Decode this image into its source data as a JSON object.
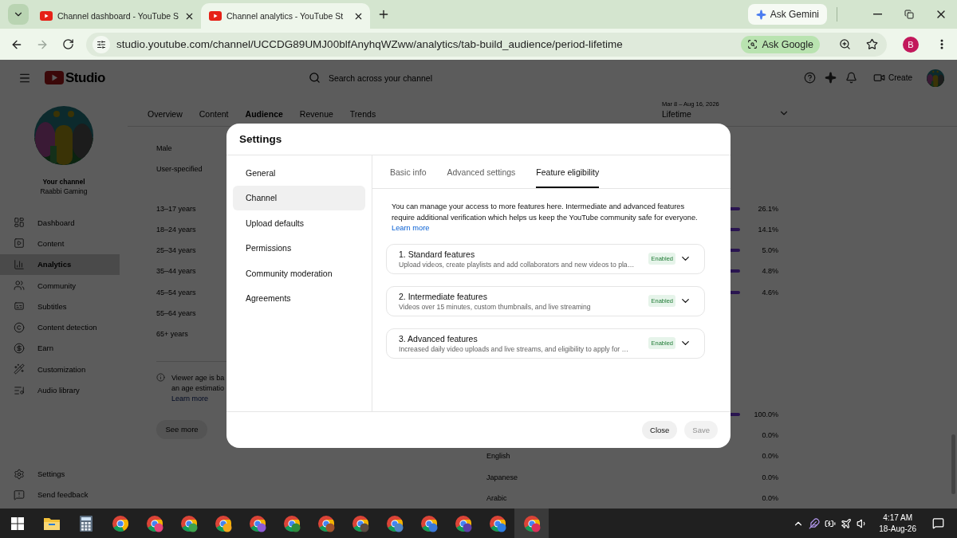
{
  "browser": {
    "tabs": [
      {
        "title": "Channel dashboard - YouTube S",
        "selected": false
      },
      {
        "title": "Channel analytics - YouTube St",
        "selected": true
      }
    ],
    "gemini_button": "Ask Gemini",
    "url": "studio.youtube.com/channel/UCCDG89UMJ00blfAnyhqWZww/analytics/tab-build_audience/period-lifetime",
    "ask_google": "Ask Google",
    "profile_initial": "B"
  },
  "studio": {
    "logo": "Studio",
    "search_placeholder": "Search across your channel",
    "create_button": "Create",
    "channel": {
      "label": "Your channel",
      "name": "Raabbi Gaming"
    },
    "nav": [
      {
        "label": "Dashboard",
        "kind": "dashboard",
        "selected": false
      },
      {
        "label": "Content",
        "kind": "content",
        "selected": false
      },
      {
        "label": "Analytics",
        "kind": "analytics",
        "selected": true
      },
      {
        "label": "Community",
        "kind": "community",
        "selected": false
      },
      {
        "label": "Subtitles",
        "kind": "subtitles",
        "selected": false
      },
      {
        "label": "Content detection",
        "kind": "detection",
        "selected": false
      },
      {
        "label": "Earn",
        "kind": "earn",
        "selected": false
      },
      {
        "label": "Customization",
        "kind": "customization",
        "selected": false
      },
      {
        "label": "Audio library",
        "kind": "audio",
        "selected": false
      }
    ],
    "footer_nav": [
      {
        "label": "Settings",
        "kind": "settings"
      },
      {
        "label": "Send feedback",
        "kind": "feedback"
      }
    ],
    "tabs": [
      {
        "label": "Overview",
        "selected": false
      },
      {
        "label": "Content",
        "selected": false
      },
      {
        "label": "Audience",
        "selected": true
      },
      {
        "label": "Revenue",
        "selected": false
      },
      {
        "label": "Trends",
        "selected": false
      }
    ],
    "date_range": {
      "range": "Mar 8 – Aug 16, 2026",
      "period": "Lifetime"
    },
    "gender_rows": [
      "Male",
      "User-specified"
    ],
    "age_rows": [
      {
        "label": "13–17 years",
        "value": "26.1%",
        "bar": true
      },
      {
        "label": "18–24 years",
        "value": "14.1%",
        "bar": true
      },
      {
        "label": "25–34 years",
        "value": "5.0%",
        "bar": true
      },
      {
        "label": "35–44 years",
        "value": "4.8%",
        "bar": true
      },
      {
        "label": "45–54 years",
        "value": "4.6%",
        "bar": true
      },
      {
        "label": "55–64 years",
        "bar": false
      },
      {
        "label": "65+ years",
        "bar": false
      }
    ],
    "note": {
      "lines": [
        "Viewer age is ba",
        "an age estimatio"
      ],
      "link": "Learn more"
    },
    "see_more": "See more",
    "language_rows": [
      {
        "value": "100.0%",
        "bar": true
      },
      {
        "value": "0.0%",
        "bar": false
      },
      {
        "label": "English",
        "value": "0.0%",
        "bar": false
      },
      {
        "label": "Japanese",
        "value": "0.0%",
        "bar": false
      },
      {
        "label": "Arabic",
        "value": "0.0%",
        "bar": false
      }
    ]
  },
  "dialog": {
    "title": "Settings",
    "nav": [
      {
        "label": "General",
        "selected": false
      },
      {
        "label": "Channel",
        "selected": true
      },
      {
        "label": "Upload defaults",
        "selected": false
      },
      {
        "label": "Permissions",
        "selected": false
      },
      {
        "label": "Community moderation",
        "selected": false
      },
      {
        "label": "Agreements",
        "selected": false
      }
    ],
    "tabs": [
      {
        "label": "Basic info",
        "selected": false
      },
      {
        "label": "Advanced settings",
        "selected": false
      },
      {
        "label": "Feature eligibility",
        "selected": true
      }
    ],
    "description": "You can manage your access to more features here. Intermediate and advanced features require additional verification which helps us keep the YouTube community safe for everyone.",
    "learn_more": "Learn more",
    "features": [
      {
        "title": "1. Standard features",
        "subtitle": "Upload videos, create playlists and add collaborators and new videos to pla…",
        "status": "Enabled",
        "expanded": false
      },
      {
        "title": "2. Intermediate features",
        "subtitle": "Videos over 15 minutes, custom thumbnails, and live streaming",
        "status": "Enabled",
        "expanded": false
      },
      {
        "title": "3. Advanced features",
        "subtitle": "Increased daily video uploads and live streams, and eligibility to apply for …",
        "status": "Enabled",
        "expanded": false
      }
    ],
    "buttons": [
      {
        "label": "Close",
        "disabled": false
      },
      {
        "label": "Save",
        "disabled": true
      }
    ]
  },
  "taskbar": {
    "apps": [
      {
        "kind": "start",
        "selected": false
      },
      {
        "kind": "explorer",
        "selected": false
      },
      {
        "kind": "calculator",
        "selected": false
      },
      {
        "kind": "chrome",
        "selected": false
      },
      {
        "kind": "chrome",
        "color": "#e5457a",
        "selected": false
      },
      {
        "kind": "chrome",
        "color": "#3fa34d",
        "selected": false
      },
      {
        "kind": "chrome",
        "color": "#f2a81d",
        "selected": false
      },
      {
        "kind": "chrome",
        "color": "#8e5bd6",
        "selected": false
      },
      {
        "kind": "chrome",
        "color": "#2e8b3d",
        "selected": false
      },
      {
        "kind": "chrome",
        "color": "#a0522d",
        "selected": false
      },
      {
        "kind": "chrome",
        "color": "#5a4a42",
        "selected": false
      },
      {
        "kind": "chrome",
        "color": "#4f86c6",
        "selected": false
      },
      {
        "kind": "chrome",
        "color": "#3b78d8",
        "selected": false
      },
      {
        "kind": "chrome",
        "color": "#5b3fa8",
        "selected": false
      },
      {
        "kind": "chrome",
        "color": "#2f7de1",
        "selected": false
      },
      {
        "kind": "chrome",
        "color": "#d9305a",
        "selected": true
      }
    ],
    "time": "4:17 AM",
    "date": "18-Aug-26"
  }
}
